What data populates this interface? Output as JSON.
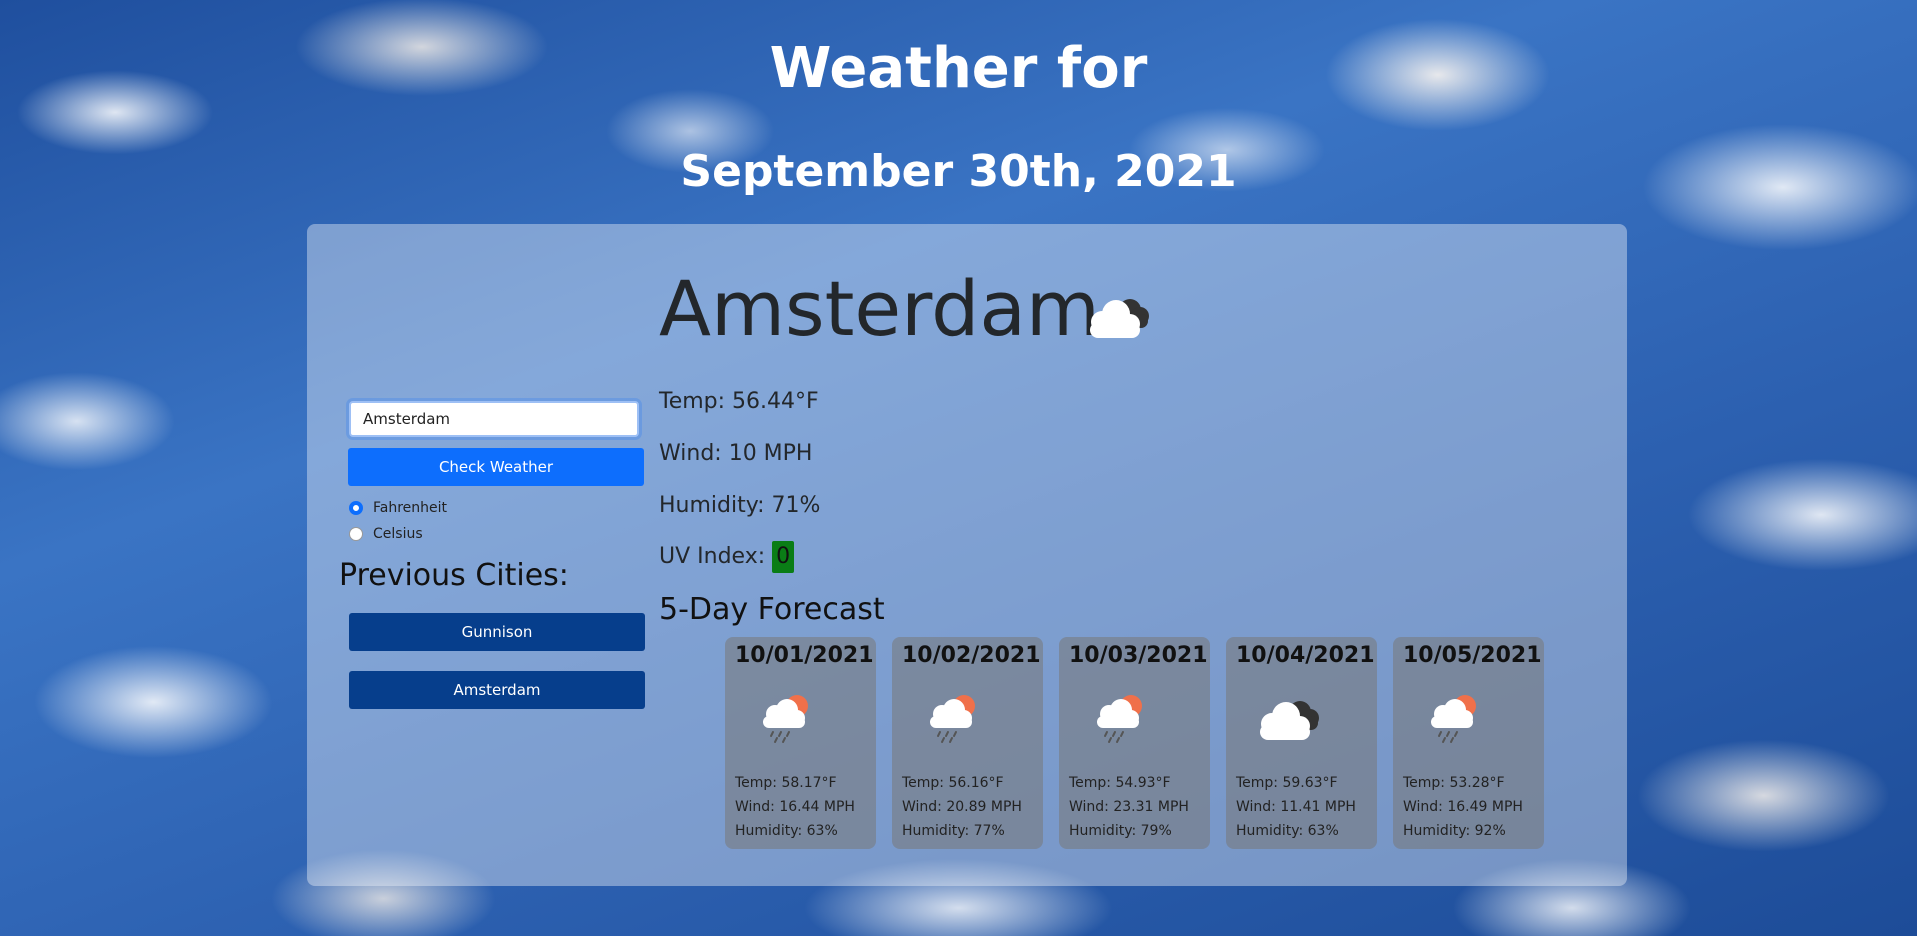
{
  "header": {
    "title": "Weather for",
    "date": "September 30th, 2021"
  },
  "search": {
    "value": "Amsterdam",
    "button_label": "Check Weather"
  },
  "units": {
    "options": [
      "Fahrenheit",
      "Celsius"
    ],
    "selected": "Fahrenheit"
  },
  "previous": {
    "title": "Previous Cities:",
    "cities": [
      "Gunnison",
      "Amsterdam"
    ]
  },
  "current": {
    "city": "Amsterdam",
    "icon": "cloudy-icon",
    "temp": "Temp: 56.44°F",
    "wind": "Wind: 10 MPH",
    "humidity": "Humidity: 71%",
    "uv_label": "UV Index:",
    "uv_value": "0",
    "uv_color": "#0a7d16"
  },
  "forecast": {
    "title": "5-Day Forecast",
    "days": [
      {
        "date": "10/01/2021",
        "icon": "rain-sun-icon",
        "temp": "Temp: 58.17°F",
        "wind": "Wind: 16.44 MPH",
        "humidity": "Humidity: 63%"
      },
      {
        "date": "10/02/2021",
        "icon": "rain-sun-icon",
        "temp": "Temp: 56.16°F",
        "wind": "Wind: 20.89 MPH",
        "humidity": "Humidity: 77%"
      },
      {
        "date": "10/03/2021",
        "icon": "rain-sun-icon",
        "temp": "Temp: 54.93°F",
        "wind": "Wind: 23.31 MPH",
        "humidity": "Humidity: 79%"
      },
      {
        "date": "10/04/2021",
        "icon": "cloudy-icon",
        "temp": "Temp: 59.63°F",
        "wind": "Wind: 11.41 MPH",
        "humidity": "Humidity: 63%"
      },
      {
        "date": "10/05/2021",
        "icon": "rain-sun-icon",
        "temp": "Temp: 53.28°F",
        "wind": "Wind: 16.49 MPH",
        "humidity": "Humidity: 92%"
      }
    ]
  },
  "colors": {
    "primary_button": "#0d6efd",
    "history_button": "#063e8c"
  }
}
